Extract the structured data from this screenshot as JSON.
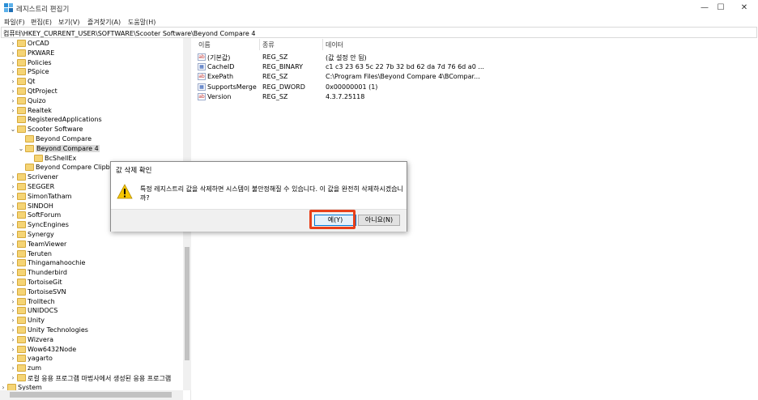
{
  "window": {
    "title": "레지스트리 편집기",
    "minimize": "—",
    "maximize": "☐",
    "close": "✕"
  },
  "menu": [
    "파일(F)",
    "편집(E)",
    "보기(V)",
    "즐겨찾기(A)",
    "도움말(H)"
  ],
  "address": "컴퓨터\\HKEY_CURRENT_USER\\SOFTWARE\\Scooter Software\\Beyond Compare 4",
  "tree": [
    {
      "label": "OrCAD",
      "level": 1,
      "expander": "›"
    },
    {
      "label": "PKWARE",
      "level": 1,
      "expander": "›"
    },
    {
      "label": "Policies",
      "level": 1,
      "expander": "›"
    },
    {
      "label": "PSpice",
      "level": 1,
      "expander": "›"
    },
    {
      "label": "Qt",
      "level": 1,
      "expander": "›"
    },
    {
      "label": "QtProject",
      "level": 1,
      "expander": "›"
    },
    {
      "label": "Quizo",
      "level": 1,
      "expander": "›"
    },
    {
      "label": "Realtek",
      "level": 1,
      "expander": "›"
    },
    {
      "label": "RegisteredApplications",
      "level": 1,
      "expander": ""
    },
    {
      "label": "Scooter Software",
      "level": 1,
      "expander": "⌄"
    },
    {
      "label": "Beyond Compare",
      "level": 2,
      "expander": ""
    },
    {
      "label": "Beyond Compare 4",
      "level": 2,
      "expander": "⌄",
      "selected": true
    },
    {
      "label": "BcShellEx",
      "level": 3,
      "expander": ""
    },
    {
      "label": "Beyond Compare Clipboa",
      "level": 2,
      "expander": ""
    },
    {
      "label": "Scrivener",
      "level": 1,
      "expander": "›"
    },
    {
      "label": "SEGGER",
      "level": 1,
      "expander": "›"
    },
    {
      "label": "SimonTatham",
      "level": 1,
      "expander": "›"
    },
    {
      "label": "SINDOH",
      "level": 1,
      "expander": "›"
    },
    {
      "label": "SoftForum",
      "level": 1,
      "expander": "›"
    },
    {
      "label": "SyncEngines",
      "level": 1,
      "expander": "›"
    },
    {
      "label": "Synergy",
      "level": 1,
      "expander": "›"
    },
    {
      "label": "TeamViewer",
      "level": 1,
      "expander": "›"
    },
    {
      "label": "Teruten",
      "level": 1,
      "expander": "›"
    },
    {
      "label": "Thingamahoochie",
      "level": 1,
      "expander": "›"
    },
    {
      "label": "Thunderbird",
      "level": 1,
      "expander": "›"
    },
    {
      "label": "TortoiseGit",
      "level": 1,
      "expander": "›"
    },
    {
      "label": "TortoiseSVN",
      "level": 1,
      "expander": "›"
    },
    {
      "label": "Trolltech",
      "level": 1,
      "expander": "›"
    },
    {
      "label": "UNIDOCS",
      "level": 1,
      "expander": "›"
    },
    {
      "label": "Unity",
      "level": 1,
      "expander": "›"
    },
    {
      "label": "Unity Technologies",
      "level": 1,
      "expander": "›"
    },
    {
      "label": "Wizvera",
      "level": 1,
      "expander": "›"
    },
    {
      "label": "Wow6432Node",
      "level": 1,
      "expander": "›"
    },
    {
      "label": "yagarto",
      "level": 1,
      "expander": "›"
    },
    {
      "label": "zum",
      "level": 1,
      "expander": "›"
    },
    {
      "label": "로컬 응용 프로그램 마법사에서 생성된 응용 프로그램",
      "level": 1,
      "expander": "›"
    },
    {
      "label": "System",
      "level": 0,
      "expander": "›"
    }
  ],
  "values_table": {
    "headers": [
      "이름",
      "종류",
      "데이터"
    ],
    "rows": [
      {
        "icon": "ab",
        "name": "(기본값)",
        "type": "REG_SZ",
        "data": "(값 설정 안 됨)"
      },
      {
        "icon": "bin",
        "name": "CacheID",
        "type": "REG_BINARY",
        "data": "c1 c3 23 63 5c 22 7b 32 bd 62 da 7d 76 6d a0 ..."
      },
      {
        "icon": "ab",
        "name": "ExePath",
        "type": "REG_SZ",
        "data": "C:\\Program Files\\Beyond Compare 4\\BCompar..."
      },
      {
        "icon": "bin",
        "name": "SupportsMerge",
        "type": "REG_DWORD",
        "data": "0x00000001 (1)"
      },
      {
        "icon": "ab",
        "name": "Version",
        "type": "REG_SZ",
        "data": "4.3.7.25118"
      }
    ]
  },
  "dialog": {
    "title": "값 삭제 확인",
    "message": "특정 레지스트리 값을 삭제하면 시스템이 불안정해질 수 있습니다. 이 값을 완전히 삭제하시겠습니까?",
    "yes_label": "예(Y)",
    "no_label": "아니요(N)"
  },
  "colors": {
    "highlight": "#e8401a",
    "folder": "#f5d475",
    "default_button_border": "#0078d7"
  }
}
